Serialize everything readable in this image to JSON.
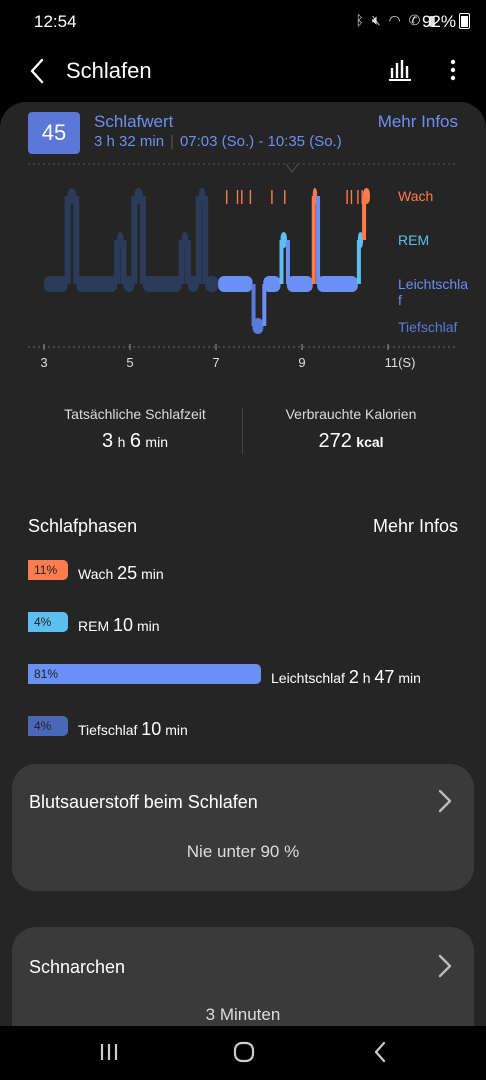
{
  "status_bar": {
    "time": "12:54",
    "icons": [
      "bluetooth-icon",
      "mute-icon",
      "wifi-icon",
      "wifi-call-icon",
      "signal-icon"
    ],
    "battery": "92%"
  },
  "app_bar": {
    "title": "Schlafen"
  },
  "score": {
    "value": "45",
    "label": "Schlafwert",
    "duration": "3 h 32 min",
    "range": "07:03 (So.) - 10:35 (So.)",
    "link": "Mehr Infos"
  },
  "chart_data": {
    "type": "hypnogram",
    "x_ticks": [
      "3",
      "5",
      "7",
      "9",
      "11(S)"
    ],
    "stages": [
      "Wach",
      "REM",
      "Leichtschlaf",
      "Tiefschlaf"
    ],
    "legend": [
      {
        "label": "Wach",
        "color": "#ff7a4d"
      },
      {
        "label": "REM",
        "color": "#5bc0f0"
      },
      {
        "label": "Leichtschlaf",
        "color": "#6a8ff5"
      },
      {
        "label": "Tiefschlaf",
        "color": "#5a7ad8"
      }
    ],
    "segments": [
      {
        "start": 7.05,
        "end": 7.85,
        "stage": "Leichtschlaf"
      },
      {
        "start": 7.85,
        "end": 8.1,
        "stage": "Tiefschlaf"
      },
      {
        "start": 8.1,
        "end": 8.5,
        "stage": "Leichtschlaf"
      },
      {
        "start": 8.5,
        "end": 8.65,
        "stage": "REM"
      },
      {
        "start": 8.65,
        "end": 9.25,
        "stage": "Leichtschlaf"
      },
      {
        "start": 9.25,
        "end": 9.35,
        "stage": "Wach"
      },
      {
        "start": 9.35,
        "end": 10.3,
        "stage": "Leichtschlaf"
      },
      {
        "start": 10.3,
        "end": 10.42,
        "stage": "REM"
      },
      {
        "start": 10.42,
        "end": 10.58,
        "stage": "Wach"
      }
    ],
    "wake_ticks": [
      7.25,
      7.5,
      7.6,
      7.8,
      8.3,
      8.6,
      10.05,
      10.15,
      10.3,
      10.4
    ],
    "history_shadow": [
      {
        "start": 3.0,
        "end": 3.55,
        "stage": "Leichtschlaf"
      },
      {
        "start": 3.55,
        "end": 3.75,
        "stage": "Wach"
      },
      {
        "start": 3.75,
        "end": 4.7,
        "stage": "Leichtschlaf"
      },
      {
        "start": 4.7,
        "end": 4.85,
        "stage": "REM"
      },
      {
        "start": 4.85,
        "end": 5.1,
        "stage": "Leichtschlaf"
      },
      {
        "start": 5.1,
        "end": 5.3,
        "stage": "Wach"
      },
      {
        "start": 5.3,
        "end": 6.2,
        "stage": "Leichtschlaf"
      },
      {
        "start": 6.2,
        "end": 6.35,
        "stage": "REM"
      },
      {
        "start": 6.35,
        "end": 6.6,
        "stage": "Leichtschlaf"
      },
      {
        "start": 6.6,
        "end": 6.75,
        "stage": "Wach"
      },
      {
        "start": 6.75,
        "end": 7.05,
        "stage": "Leichtschlaf"
      }
    ]
  },
  "stats": {
    "actual": {
      "label": "Tatsächliche Schlafzeit",
      "h": "3",
      "h_unit": "h",
      "m": "6",
      "m_unit": "min"
    },
    "calories": {
      "label": "Verbrauchte Kalorien",
      "value": "272",
      "unit": "kcal"
    }
  },
  "phases": {
    "title": "Schlafphasen",
    "link": "Mehr Infos",
    "items": [
      {
        "pct": "11%",
        "name": "Wach",
        "t1": "25",
        "u1": "min",
        "t2": "",
        "u2": "",
        "color": "#ff7a4d",
        "fraction": 0.11
      },
      {
        "pct": "4%",
        "name": "REM",
        "t1": "10",
        "u1": "min",
        "t2": "",
        "u2": "",
        "color": "#5bc0f0",
        "fraction": 0.04
      },
      {
        "pct": "81%",
        "name": "Leichtschlaf",
        "t1": "2",
        "u1": "h",
        "t2": "47",
        "u2": "min",
        "color": "#6a8ff5",
        "fraction": 0.81
      },
      {
        "pct": "4%",
        "name": "Tiefschlaf",
        "t1": "10",
        "u1": "min",
        "t2": "",
        "u2": "",
        "color": "#4a67b8",
        "fraction": 0.04
      }
    ]
  },
  "cards": {
    "oxygen": {
      "title": "Blutsauerstoff beim Schlafen",
      "value": "Nie unter 90 %"
    },
    "snoring": {
      "title": "Schnarchen",
      "value": "3 Minuten"
    }
  },
  "navbar": {
    "buttons": [
      "recents-icon",
      "home-icon",
      "back-icon"
    ]
  }
}
